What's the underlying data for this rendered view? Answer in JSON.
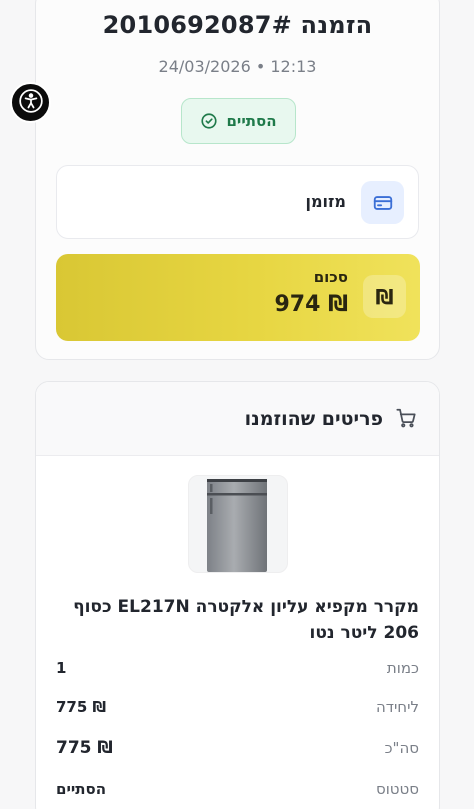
{
  "order": {
    "title": "הזמנה 2010692087#",
    "date": "12:13 • 24/03/2026",
    "status": "הסתיים",
    "state_label": "מזומן",
    "sum_label": "סכום",
    "sum_value": "₪ 974",
    "currency_symbol": "₪"
  },
  "items": {
    "header": "פריטים שהוזמנו",
    "product": {
      "title": "מקרר מקפיא עליון אלקטרה EL217N כסוף 206 ליטר נטו",
      "image_icon": "refrigerator-image"
    },
    "details": [
      {
        "label": "כמות",
        "value": "1"
      },
      {
        "label": "ליחידה",
        "value": "₪ 775"
      },
      {
        "label": "סה\"כ",
        "value": "₪ 775"
      },
      {
        "label": "סטטוס",
        "value": "הסתיים"
      }
    ]
  },
  "icons": {
    "accessibility": "accessibility-icon",
    "status": "check-circle-icon",
    "payment": "credit-card-icon",
    "cart": "shopping-cart-icon"
  },
  "colors": {
    "success_green": "#1f7a4a",
    "success_bg": "#e8f8ef",
    "accent_yellow": "#e4d23e",
    "payment_icon_blue": "#3b6fd6"
  }
}
